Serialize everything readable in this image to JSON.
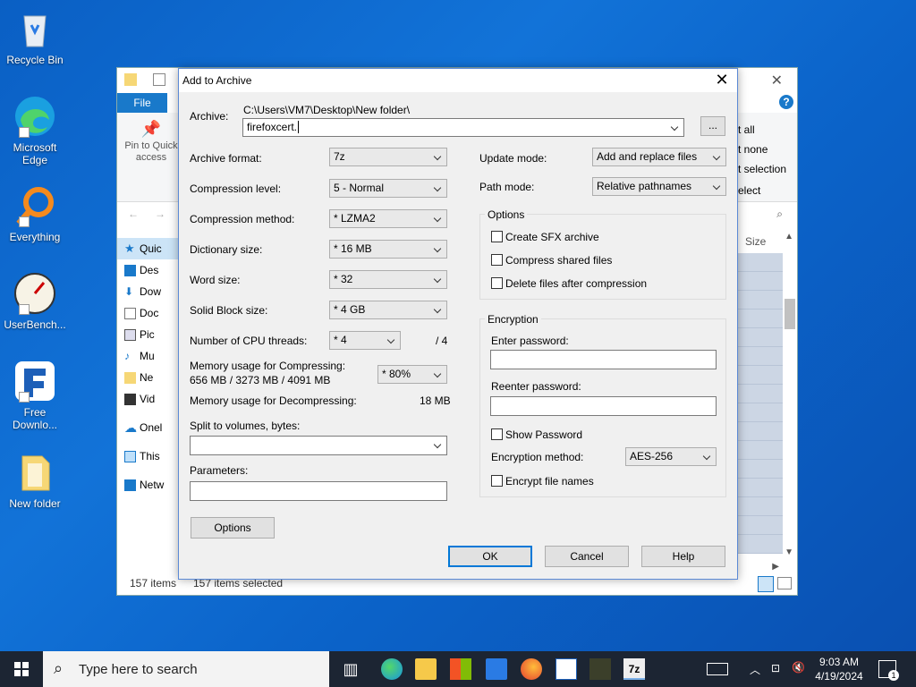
{
  "desktop": {
    "icons": [
      {
        "label": "Recycle Bin"
      },
      {
        "label": "Microsoft Edge"
      },
      {
        "label": "Everything"
      },
      {
        "label": "UserBench..."
      },
      {
        "label": "Free Downlo..."
      },
      {
        "label": "New folder"
      }
    ]
  },
  "explorer": {
    "file_tab": "File",
    "pin_label": "Pin to Quick access",
    "ribbon_right": [
      "t all",
      "t none",
      "t selection",
      "elect"
    ],
    "size_header": "Size",
    "nav_items": [
      "Quic",
      "Des",
      "Dow",
      "Doc",
      "Pic",
      "Mu",
      "Ne",
      "Vid",
      "Onel",
      "This",
      "Netw"
    ],
    "status_items": "157 items",
    "status_selected": "157 items selected"
  },
  "dialog": {
    "title": "Add to Archive",
    "archive_label": "Archive:",
    "archive_path": "C:\\Users\\VM7\\Desktop\\New folder\\",
    "archive_name": "firefoxcert.",
    "browse_label": "...",
    "archive_format_label": "Archive format:",
    "archive_format": "7z",
    "compression_level_label": "Compression level:",
    "compression_level": "5 - Normal",
    "compression_method_label": "Compression method:",
    "compression_method": "* LZMA2",
    "dictionary_size_label": "Dictionary size:",
    "dictionary_size": "* 16 MB",
    "word_size_label": "Word size:",
    "word_size": "* 32",
    "solid_block_label": "Solid Block size:",
    "solid_block": "* 4 GB",
    "cpu_threads_label": "Number of CPU threads:",
    "cpu_threads": "* 4",
    "cpu_threads_max": "/ 4",
    "mem_compress_label": "Memory usage for Compressing:",
    "mem_compress_value": "656 MB / 3273 MB / 4091 MB",
    "mem_compress_pct": "* 80%",
    "mem_decompress_label": "Memory usage for Decompressing:",
    "mem_decompress_value": "18 MB",
    "split_label": "Split to volumes, bytes:",
    "split_value": "",
    "parameters_label": "Parameters:",
    "parameters_value": "",
    "options_button": "Options",
    "update_mode_label": "Update mode:",
    "update_mode": "Add and replace files",
    "path_mode_label": "Path mode:",
    "path_mode": "Relative pathnames",
    "options_group": "Options",
    "create_sfx": "Create SFX archive",
    "compress_shared": "Compress shared files",
    "delete_after": "Delete files after compression",
    "encryption_group": "Encryption",
    "enter_password_label": "Enter password:",
    "reenter_password_label": "Reenter password:",
    "show_password": "Show Password",
    "encryption_method_label": "Encryption method:",
    "encryption_method": "AES-256",
    "encrypt_names": "Encrypt file names",
    "ok": "OK",
    "cancel": "Cancel",
    "help": "Help"
  },
  "taskbar": {
    "search_placeholder": "Type here to search",
    "time": "9:03 AM",
    "date": "4/19/2024",
    "notification_count": "1"
  }
}
